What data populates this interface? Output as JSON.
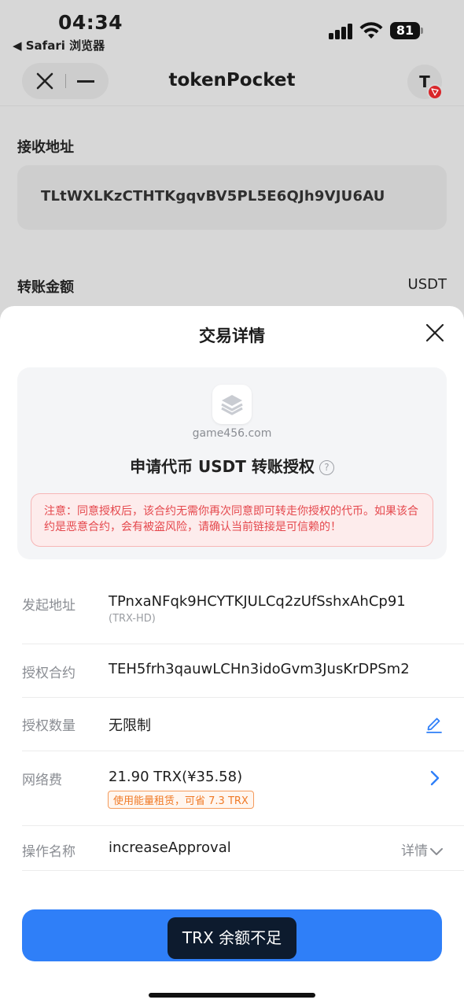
{
  "status_bar": {
    "time": "04:34",
    "back_app": "◀ Safari 浏览器",
    "battery": "81"
  },
  "nav": {
    "title": "tokenPocket",
    "wallet_initial": "T"
  },
  "background": {
    "receive_label": "接收地址",
    "receive_address": "TLtWXLKzCTHTKgqvBV5PL5E6QJh9VJU6AU",
    "amount_label": "转账金额",
    "amount_unit": "USDT"
  },
  "sheet": {
    "title": "交易详情",
    "dapp_domain": "game456.com",
    "request_title": "申请代币 USDT 转账授权",
    "help_glyph": "?",
    "warning": "注意：同意授权后，该合约无需你再次同意即可转走你授权的代币。如果该合约是恶意合约，会有被盗风险，请确认当前链接是可信赖的！",
    "rows": {
      "from": {
        "label": "发起地址",
        "value": "TPnxaNFqk9HCYTKJULCq2zUfSshxAhCp91",
        "sub": "(TRX-HD)"
      },
      "contract": {
        "label": "授权合约",
        "value": "TEH5frh3qauwLCHn3idoGvm3JusKrDPSm2"
      },
      "amount": {
        "label": "授权数量",
        "value": "无限制"
      },
      "fee": {
        "label": "网络费",
        "value": "21.90 TRX(¥35.58)",
        "tag": "使用能量租赁，可省 7.3 TRX"
      },
      "method": {
        "label": "操作名称",
        "value": "increaseApproval",
        "detail": "详情"
      }
    },
    "toast": "TRX 余额不足"
  },
  "colors": {
    "accent": "#2f7ff8",
    "warning": "#e5484d",
    "fee_tag": "#f07a26"
  },
  "icons": [
    "close-icon",
    "minimize-icon",
    "tron-badge-icon",
    "dapp-layers-icon",
    "help-icon",
    "edit-icon",
    "chevron-right-icon",
    "chevron-down-icon"
  ]
}
